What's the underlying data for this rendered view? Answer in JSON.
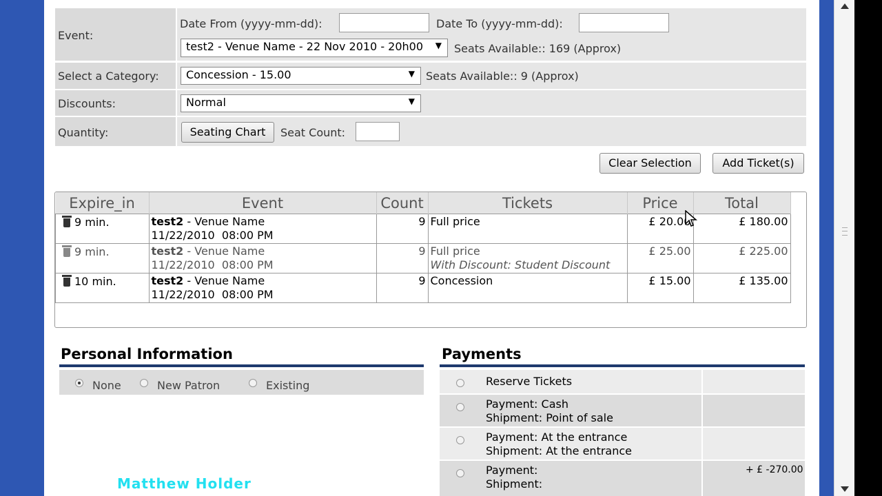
{
  "form": {
    "event_label": "Event:",
    "date_from_label": "Date From (yyyy-mm-dd):",
    "date_from_value": "",
    "date_to_label": "Date To (yyyy-mm-dd):",
    "date_to_value": "",
    "event_select": "test2 - Venue Name - 22 Nov 2010 - 20h00",
    "event_seats": "Seats Available:: 169 (Approx)",
    "category_label": "Select a Category:",
    "category_select": "Concession - 15.00",
    "category_seats": "Seats Available:: 9 (Approx)",
    "discounts_label": "Discounts:",
    "discount_select": "Normal",
    "quantity_label": "Quantity:",
    "seating_chart_button": "Seating Chart",
    "seat_count_label": "Seat Count:",
    "seat_count_value": "",
    "clear_button": "Clear Selection",
    "add_button": "Add Ticket(s)"
  },
  "cart": {
    "headers": [
      "Expire_in",
      "Event",
      "Count",
      "Tickets",
      "Price",
      "Total"
    ],
    "rows": [
      {
        "expire": "9 min.",
        "event_name": "test2",
        "venue": " - Venue Name",
        "date": "11/22/2010  08:00 PM",
        "count": "9",
        "ticket": "Full price",
        "discount": "",
        "price": "£ 20.00",
        "total": "£ 180.00"
      },
      {
        "expire": "9 min.",
        "event_name": "test2",
        "venue": " - Venue Name",
        "date": "11/22/2010  08:00 PM",
        "count": "9",
        "ticket": "Full price",
        "discount": "With Discount: Student Discount",
        "price": "£ 25.00",
        "total": "£ 225.00"
      },
      {
        "expire": "10 min.",
        "event_name": "test2",
        "venue": " - Venue Name",
        "date": "11/22/2010  08:00 PM",
        "count": "9",
        "ticket": "Concession",
        "discount": "",
        "price": "£ 15.00",
        "total": "£ 135.00"
      }
    ]
  },
  "personal": {
    "title": "Personal Information",
    "options": [
      "None",
      "New Patron",
      "Existing"
    ],
    "selected": "None"
  },
  "payments": {
    "title": "Payments",
    "options": [
      {
        "line1": "Reserve Tickets",
        "line2": "",
        "amount": ""
      },
      {
        "line1": "Payment: Cash",
        "line2": "Shipment: Point of sale",
        "amount": ""
      },
      {
        "line1": "Payment: At the entrance",
        "line2": "Shipment: At the entrance",
        "amount": ""
      },
      {
        "line1": "Payment:",
        "line2": "Shipment:",
        "amount": "+ £ -270.00"
      }
    ]
  },
  "watermark": "Matthew Holder",
  "colors": {
    "background_blue": "#2e57b3",
    "rule_navy": "#1e3a6e",
    "watermark_cyan": "#22e0f0"
  }
}
